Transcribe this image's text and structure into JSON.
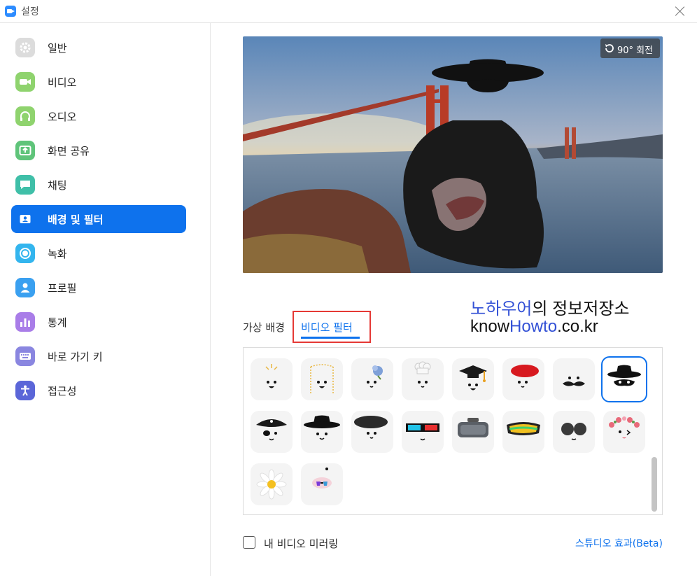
{
  "window": {
    "title": "설정",
    "close_icon": "close-icon"
  },
  "sidebar": {
    "items": [
      {
        "label": "일반",
        "icon": "gear-icon",
        "color": "#d9d9d9",
        "active": false
      },
      {
        "label": "비디오",
        "icon": "video-camera-icon",
        "color": "#8fd36e",
        "active": false
      },
      {
        "label": "오디오",
        "icon": "headphones-icon",
        "color": "#8fd36e",
        "active": false
      },
      {
        "label": "화면 공유",
        "icon": "share-screen-icon",
        "color": "#5fc47a",
        "active": false
      },
      {
        "label": "채팅",
        "icon": "chat-bubble-icon",
        "color": "#3fbfa8",
        "active": false
      },
      {
        "label": "배경 및 필터",
        "icon": "background-portrait-icon",
        "color": "#0e72ed",
        "active": true
      },
      {
        "label": "녹화",
        "icon": "record-icon",
        "color": "#33b5ee",
        "active": false
      },
      {
        "label": "프로필",
        "icon": "user-icon",
        "color": "#3aa0f0",
        "active": false
      },
      {
        "label": "통계",
        "icon": "bar-chart-icon",
        "color": "#a97de8",
        "active": false
      },
      {
        "label": "바로 가기 키",
        "icon": "keyboard-icon",
        "color": "#8a86e0",
        "active": false
      },
      {
        "label": "접근성",
        "icon": "accessibility-icon",
        "color": "#5b66d8",
        "active": false
      }
    ]
  },
  "preview": {
    "rotate_label": "90° 회전",
    "rotate_icon": "rotate-icon"
  },
  "watermark": {
    "line1_highlight": "노하우어",
    "line1_rest": "의 정보저장소",
    "line2_pre": "know",
    "line2_highlight": "Howto",
    "line2_post": ".co.kr"
  },
  "tabs": {
    "virtual_background": "가상 배경",
    "video_filter": "비디오 필터"
  },
  "filters": {
    "rows": [
      [
        "sparkle-crown-filter",
        "golden-frame-filter",
        "flower-hydrangea-filter",
        "chef-hat-filter",
        "graduation-cap-filter",
        "red-beret-filter",
        "mustache-filter",
        "black-fedora-mask-filter"
      ],
      [
        "pirate-hat-filter",
        "black-hat-filter",
        "black-beret-filter",
        "3d-glasses-filter",
        "vr-headset-filter",
        "ski-goggles-filter",
        "round-sunglasses-filter",
        "flower-crown-filter"
      ],
      [
        "daisy-filter",
        "rainbow-sparkle-filter"
      ]
    ],
    "selected": "black-fedora-mask-filter"
  },
  "options": {
    "mirror_label": "내 비디오 미러링",
    "mirror_checked": false,
    "studio_effects": "스튜디오 효과(Beta)"
  },
  "colors": {
    "accent": "#0e72ed",
    "highlight_box": "#e53935"
  }
}
